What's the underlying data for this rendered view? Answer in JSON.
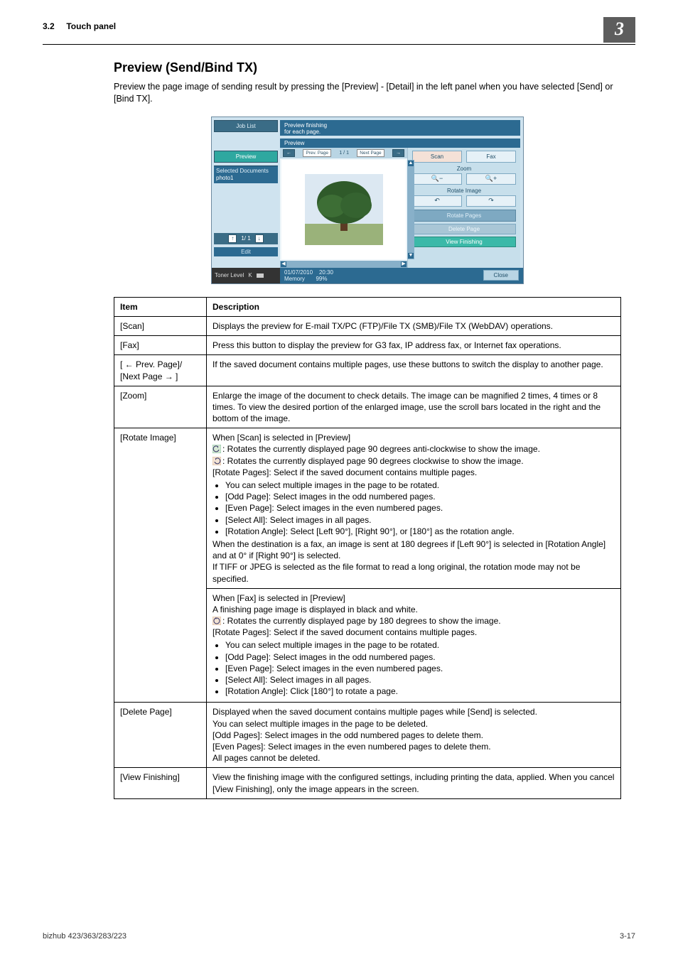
{
  "header": {
    "section_no": "3.2",
    "section_label": "Touch panel",
    "chapter_badge": "3"
  },
  "title": "Preview (Send/Bind TX)",
  "intro": "Preview the page image of sending result by pressing the [Preview] - [Detail] in the left panel when you have selected [Send] or [Bind TX].",
  "screenshot": {
    "job_list_tab": "Job List",
    "preview_tab": "Preview",
    "selected_docs_label": "Selected Documents",
    "doc_name": "photo1",
    "pager_label": "1/  1",
    "edit_tab": "Edit",
    "toner_label": "Toner Level",
    "toner_letter": "K",
    "message_line1": "Preview finishing",
    "message_line2": "for each page.",
    "preview_panel_title": "Preview",
    "prev_page_label": "Prev. Page",
    "next_page_label": "Next Page",
    "page_counter": "1 /      1",
    "tabs": {
      "scan": "Scan",
      "fax": "Fax"
    },
    "zoom_label": "Zoom",
    "zoom_minus_icon": "🔍−",
    "zoom_plus_icon": "🔍+",
    "rotate_image_label": "Rotate Image",
    "rotate_ccw_icon": "↶",
    "rotate_cw_icon": "↷",
    "rotate_pages_btn": "Rotate Pages",
    "delete_page_btn": "Delete Page",
    "view_finishing_btn": "View Finishing",
    "status_date": "01/07/2010",
    "status_time": "20:30",
    "status_memory_label": "Memory",
    "status_memory_value": "99%",
    "close_btn": "Close"
  },
  "table": {
    "head_item": "Item",
    "head_desc": "Description",
    "rows": [
      {
        "item": "[Scan]",
        "desc_plain": "Displays the preview for E-mail TX/PC (FTP)/File TX (SMB)/File TX (WebDAV) operations."
      },
      {
        "item": "[Fax]",
        "desc_plain": "Press this button to display the preview for G3 fax, IP address fax, or Internet fax operations."
      },
      {
        "item": "[ ← Prev. Page]/\n[Next Page → ]",
        "desc_plain": "If the saved document contains multiple pages, use these buttons to switch the display to another page."
      },
      {
        "item": "[Zoom]",
        "desc_plain": "Enlarge the image of the document to check details. The image can be magnified 2 times, 4 times or 8 times. To view the desired portion of the enlarged image, use the scroll bars located in the right and the bottom of the image."
      },
      {
        "item": "[Rotate Image]",
        "rotate_scan": {
          "lead": "When [Scan] is selected in [Preview]",
          "ccw": ": Rotates the currently displayed page 90 degrees anti-clockwise to show the image.",
          "cw": ": Rotates the currently displayed page 90 degrees clockwise to show the image.",
          "rotate_pages": "[Rotate Pages]: Select if the saved document contains multiple pages.",
          "bullets": [
            "You can select multiple images in the page to be rotated.",
            "[Odd Page]: Select images in the odd numbered pages.",
            "[Even Page]: Select images in the even numbered pages.",
            "[Select All]: Select images in all pages.",
            "[Rotation Angle]: Select [Left 90°], [Right 90°], or [180°] as the rotation angle."
          ],
          "tail1": "When the destination is a fax, an image is sent at 180 degrees if [Left 90°] is selected in [Rotation Angle] and at 0° if [Right 90°] is selected.",
          "tail2": "If TIFF or JPEG is selected as the file format to read a long original, the rotation mode may not be specified."
        },
        "rotate_fax": {
          "lead": "When [Fax] is selected in [Preview]",
          "line2": "A finishing page image is displayed in black and white.",
          "r180": ": Rotates the currently displayed page by 180 degrees to show the image.",
          "rotate_pages": "[Rotate Pages]: Select if the saved document contains multiple pages.",
          "bullets": [
            "You can select multiple images in the page to be rotated.",
            "[Odd Page]: Select images in the odd numbered pages.",
            "[Even Page]: Select images in the even numbered pages.",
            "[Select All]: Select images in all pages.",
            "[Rotation Angle]: Click [180°] to rotate a page."
          ]
        }
      },
      {
        "item": "[Delete Page]",
        "delete": {
          "l1": "Displayed when the saved document contains multiple pages while [Send] is selected.",
          "l2": "You can select multiple images in the page to be deleted.",
          "l3": "[Odd Pages]: Select images in the odd numbered pages to delete them.",
          "l4": "[Even Pages]: Select images in the even numbered pages to delete them.",
          "l5": "All pages cannot be deleted."
        }
      },
      {
        "item": "[View Finishing]",
        "desc_plain": "View the finishing image with the configured settings, including printing the data, applied. When you cancel [View Finishing], only the image appears in the screen."
      }
    ]
  },
  "footer": {
    "model": "bizhub 423/363/283/223",
    "page": "3-17"
  }
}
